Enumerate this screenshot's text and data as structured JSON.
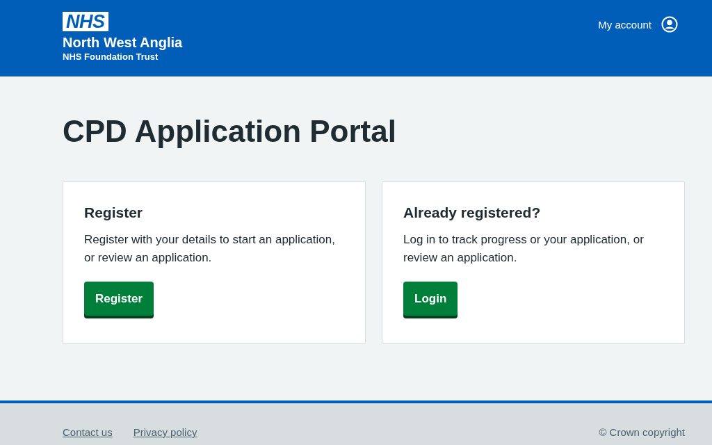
{
  "header": {
    "logo": "NHS",
    "organisation": "North West Anglia",
    "trust": "NHS Foundation Trust",
    "account_link": "My account"
  },
  "page_title": "CPD Application Portal",
  "cards": [
    {
      "title": "Register",
      "text": "Register with your details to start an application, or review an application.",
      "button": "Register"
    },
    {
      "title": "Already registered?",
      "text": "Log in to track progress or your application, or review an application.",
      "button": "Login"
    }
  ],
  "footer": {
    "links": [
      "Contact us",
      "Privacy policy"
    ],
    "copyright": "© Crown copyright"
  }
}
